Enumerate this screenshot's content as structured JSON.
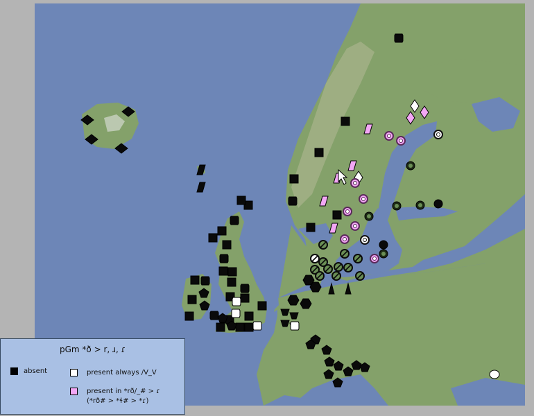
{
  "map": {
    "colors": {
      "ocean": "#6d86b7",
      "land": "#84a16a",
      "land_light": "#a9b48d",
      "land_dark": "#5f7e4e",
      "snow": "#dfe3e0",
      "marker_dark": "#0a0a0a",
      "marker_pink": "#f3a7f5",
      "marker_white": "#ffffff"
    },
    "marker_groups": [
      "absent",
      "present-always",
      "present-in-rdh",
      "ring-pink",
      "ring-white",
      "ring-dark",
      "slash-circle",
      "triangle"
    ]
  },
  "legend": {
    "title": "pGm *ð > r, ɹ, ɾ",
    "items": [
      {
        "id": "absent",
        "label": "absent",
        "color": "#000000"
      },
      {
        "id": "present-always",
        "label": "present always /V_V",
        "color": "#ffffff"
      },
      {
        "id": "present-in-rdh",
        "label": "present in *rð/_# > ɾ",
        "sublabel": "(*rð# > *ɬ# > *ɾ)",
        "color": "#f3a7f5"
      }
    ]
  }
}
